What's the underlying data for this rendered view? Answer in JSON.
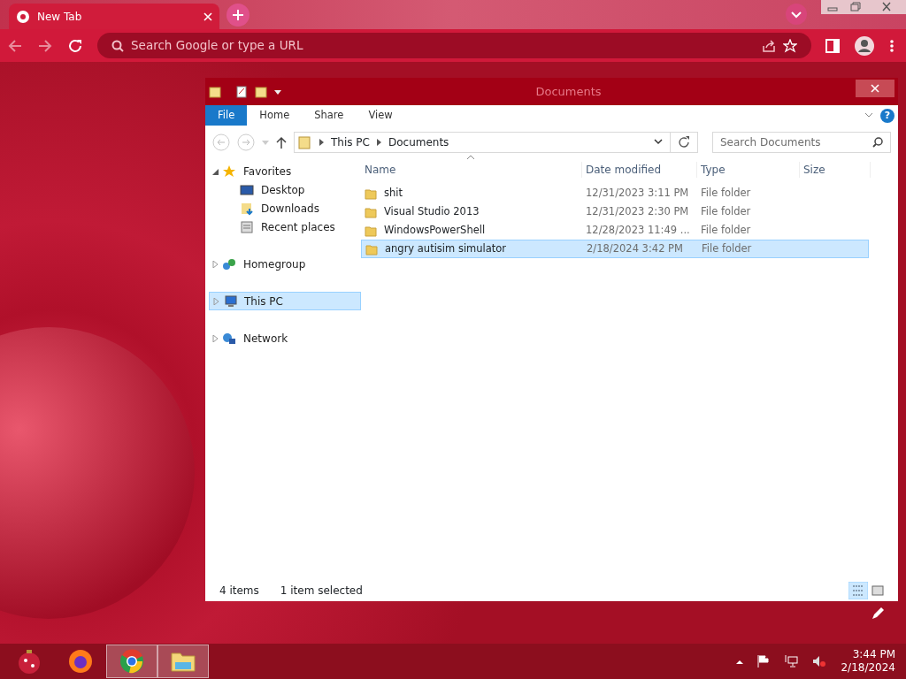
{
  "browser": {
    "tab": {
      "title": "New Tab",
      "selected": true
    },
    "address_bar": {
      "placeholder": "Search Google or type a URL"
    }
  },
  "explorer": {
    "title": "Documents",
    "ribbon_tabs": [
      {
        "label": "File",
        "selected": true
      },
      {
        "label": "Home",
        "selected": false
      },
      {
        "label": "Share",
        "selected": false
      },
      {
        "label": "View",
        "selected": false
      }
    ],
    "breadcrumb": [
      "This PC",
      "Documents"
    ],
    "search": {
      "placeholder": "Search Documents"
    },
    "help": "?",
    "nav": [
      {
        "label": "Favorites",
        "kind": "star",
        "expanded": true,
        "selected": false,
        "children": [
          {
            "label": "Desktop",
            "kind": "desktop",
            "selected": false
          },
          {
            "label": "Downloads",
            "kind": "downloads",
            "selected": false
          },
          {
            "label": "Recent places",
            "kind": "recent",
            "selected": false
          }
        ]
      },
      {
        "label": "Homegroup",
        "kind": "homegroup",
        "expanded": false,
        "selected": false
      },
      {
        "label": "This PC",
        "kind": "pc",
        "expanded": false,
        "selected": true
      },
      {
        "label": "Network",
        "kind": "network",
        "expanded": false,
        "selected": false
      }
    ],
    "columns": [
      "Name",
      "Date modified",
      "Type",
      "Size"
    ],
    "rows": [
      {
        "name": "shit",
        "date": "12/31/2023 3:11 PM",
        "type": "File folder",
        "selected": false
      },
      {
        "name": "Visual Studio 2013",
        "date": "12/31/2023 2:30 PM",
        "type": "File folder",
        "selected": false
      },
      {
        "name": "WindowsPowerShell",
        "date": "12/28/2023 11:49 ...",
        "type": "File folder",
        "selected": false
      },
      {
        "name": "angry autisim simulator",
        "date": "2/18/2024 3:42 PM",
        "type": "File folder",
        "selected": true
      }
    ],
    "status": {
      "count": "4 items",
      "selection": "1 item selected"
    }
  },
  "taskbar": {
    "apps": [
      {
        "kind": "ornament",
        "active": false
      },
      {
        "kind": "firefox",
        "active": false
      },
      {
        "kind": "chrome",
        "active": true
      },
      {
        "kind": "explorer",
        "active": true
      }
    ],
    "clock": {
      "time": "3:44 PM",
      "date": "2/18/2024"
    }
  }
}
